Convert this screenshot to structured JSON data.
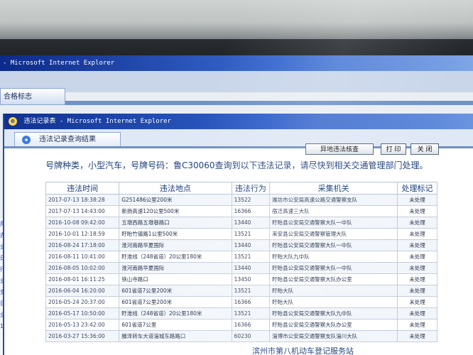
{
  "background_window": {
    "title": "- Microsoft Internet Explorer",
    "tab": "合格标志"
  },
  "popup": {
    "title": "违法记录表 - Microsoft Internet Explorer",
    "tab": "违法记录查询结果"
  },
  "buttons": {
    "remote": "异地违法核查",
    "print": "打 印",
    "close": "关 闭"
  },
  "message": "号牌种类，小型汽车，号牌号码：鲁C30060查询到以下违法记录，请尽快到相关交通管理部门处理。",
  "table": {
    "headers": [
      "违法时间",
      "违法地点",
      "违法行为",
      "采集机关",
      "处理标记"
    ],
    "rows": [
      [
        "2017-07-13 18:38:28",
        "G251486公里200米",
        "13522",
        "潍坊市公安局高速公路交通警察支队",
        "未处理"
      ],
      [
        "2017-07-13 14:43:00",
        "新扬高速120公里500米",
        "16366",
        "宿迁高速三大队",
        "未处理"
      ],
      [
        "2016-10-08 09:42:00",
        "五墩西路五墩巷路口",
        "13440",
        "盱眙县公安局交通警察大队一中队",
        "未处理"
      ],
      [
        "2016-10-01 12:18:59",
        "盱眙竹镇路1公里500米",
        "13521",
        "来安县公安局交通警察管理大队",
        "未处理"
      ],
      [
        "2016-08-24 17:18:00",
        "淮河南路华夏国际",
        "13440",
        "盱眙县公安局交通警察大队一中队",
        "未处理"
      ],
      [
        "2016-08-11 10:41:00",
        "盱淮线（248省道）20公里180米",
        "13521",
        "盱眙大队九中队",
        "未处理"
      ],
      [
        "2016-08-05 10:02:00",
        "淮河南路华夏国际",
        "13440",
        "盱眙县公安局交通警察大队一中队",
        "未处理"
      ],
      [
        "2016-08-01 16:11:25",
        "铁山寺路口",
        "13450",
        "盱眙县公安局交通警察大队办公室",
        "未处理"
      ],
      [
        "2016-06-04 16:20:00",
        "601省道7公里200米",
        "13521",
        "盱眙大队",
        "未处理"
      ],
      [
        "2016-05-24 20:37:00",
        "601省道7公里200米",
        "16366",
        "盱眙大队",
        "未处理"
      ],
      [
        "2016-05-17 10:50:00",
        "盱淮线（248省道）20公里180米",
        "13521",
        "盱眙县公安局交通警察大队九中队",
        "未处理"
      ],
      [
        "2016-05-13 23:42:00",
        "601省道7公里",
        "16366",
        "盱眙县公安局交通警察大队办公室",
        "未处理"
      ],
      [
        "2016-03-27 15:36:00",
        "滕泽转车大道淄城东路路口",
        "60230",
        "淄博市公安局交通警察支队淄川大队",
        "未处理"
      ]
    ]
  },
  "footer": "滨州市第八机动车登记服务站",
  "side_links": [
    "用",
    "办",
    "业务",
    "日",
    "行证",
    "业务",
    "变更",
    "日",
    "业务",
    "1"
  ]
}
